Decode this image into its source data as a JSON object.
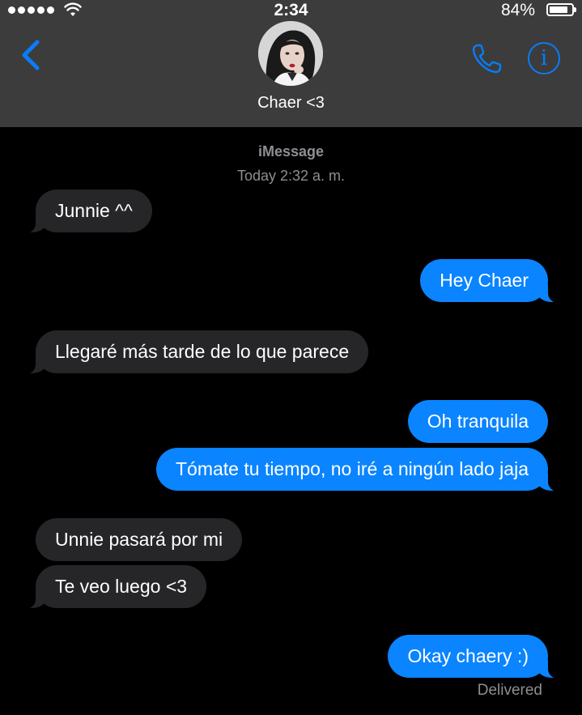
{
  "status_bar": {
    "time": "2:34",
    "battery_percent_label": "84%",
    "battery_level": 0.84,
    "signal_bars": 5,
    "signal_icon": "signal-dots-icon",
    "wifi_icon": "wifi-icon",
    "battery_icon": "battery-icon"
  },
  "header": {
    "contact_name": "Chaer <3",
    "back_icon": "chevron-left-icon",
    "call_icon": "phone-icon",
    "info_icon": "info-icon",
    "info_glyph": "i",
    "avatar_icon": "contact-avatar"
  },
  "thread": {
    "service": "iMessage",
    "timestamp": "Today 2:32 a. m.",
    "messages": [
      {
        "direction": "received",
        "text": "Junnie ^^"
      },
      {
        "direction": "sent",
        "text": "Hey Chaer"
      },
      {
        "direction": "received",
        "text": "Llegaré más tarde de lo que parece"
      },
      {
        "direction": "sent",
        "text": "Oh tranquila"
      },
      {
        "direction": "sent",
        "text": "Tómate tu tiempo, no iré a ningún lado jaja"
      },
      {
        "direction": "received",
        "text": "Unnie pasará por mi"
      },
      {
        "direction": "received",
        "text": "Te veo luego <3"
      },
      {
        "direction": "sent",
        "text": "Okay chaery :)"
      }
    ],
    "delivery_status": "Delivered"
  },
  "colors": {
    "header_background": "#3c3c3c",
    "background": "#000000",
    "accent_blue": "#0a7cf5",
    "sent_bubble": "#0a84ff",
    "received_bubble": "#262628",
    "meta_text": "#8e8e93"
  }
}
